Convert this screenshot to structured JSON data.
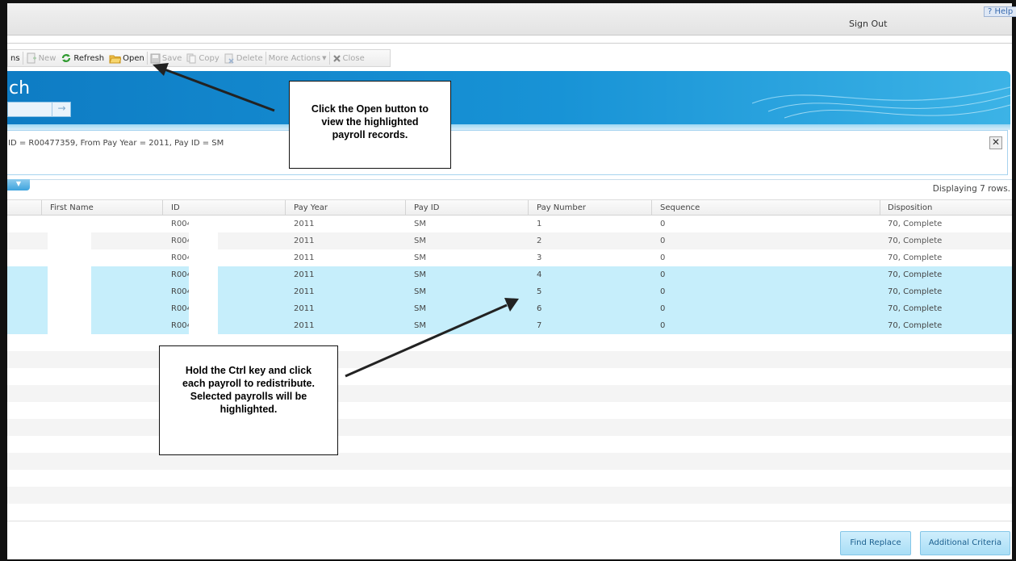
{
  "topbar": {
    "signout": "Sign Out",
    "help": "? Help"
  },
  "toolbar": {
    "partial": "ns",
    "new": "New",
    "refresh": "Refresh",
    "open": "Open",
    "save": "Save",
    "copy": "Copy",
    "delete": "Delete",
    "more": "More Actions",
    "close": "Close"
  },
  "banner": {
    "title": "ch",
    "go_arrow": "→"
  },
  "criteria": {
    "text": "ID = R00477359, From Pay Year = 2011, Pay ID = SM",
    "close": "✕"
  },
  "grid": {
    "dropdown": "▼",
    "displaying": "Displaying 7 rows.",
    "headers": {
      "first_name": "First Name",
      "id": "ID",
      "pay_year": "Pay Year",
      "pay_id": "Pay ID",
      "pay_number": "Pay Number",
      "sequence": "Sequence",
      "disposition": "Disposition"
    },
    "rows": [
      {
        "id": "R004",
        "pay_year": "2011",
        "pay_id": "SM",
        "pay_number": "1",
        "sequence": "0",
        "disposition": "70, Complete"
      },
      {
        "id": "R004",
        "pay_year": "2011",
        "pay_id": "SM",
        "pay_number": "2",
        "sequence": "0",
        "disposition": "70, Complete"
      },
      {
        "id": "R004",
        "pay_year": "2011",
        "pay_id": "SM",
        "pay_number": "3",
        "sequence": "0",
        "disposition": "70, Complete"
      },
      {
        "id": "R004",
        "pay_year": "2011",
        "pay_id": "SM",
        "pay_number": "4",
        "sequence": "0",
        "disposition": "70, Complete"
      },
      {
        "id": "R004",
        "pay_year": "2011",
        "pay_id": "SM",
        "pay_number": "5",
        "sequence": "0",
        "disposition": "70, Complete"
      },
      {
        "id": "R004",
        "pay_year": "2011",
        "pay_id": "SM",
        "pay_number": "6",
        "sequence": "0",
        "disposition": "70, Complete"
      },
      {
        "id": "R004",
        "pay_year": "2011",
        "pay_id": "SM",
        "pay_number": "7",
        "sequence": "0",
        "disposition": "70, Complete"
      }
    ]
  },
  "buttons": {
    "find_replace": "Find Replace",
    "additional_criteria": "Additional Criteria"
  },
  "callouts": {
    "open": {
      "line1": "Click the Open button to",
      "line2": "view the highlighted",
      "line3": "payroll records."
    },
    "ctrl": {
      "line1": "Hold the Ctrl key and click",
      "line2": "each payroll to redistribute.",
      "line3": "Selected payrolls will be",
      "line4": "highlighted."
    }
  },
  "colors": {
    "banner": "#1893d6",
    "selected_row": "#c6eefb",
    "button": "#a9def6"
  }
}
